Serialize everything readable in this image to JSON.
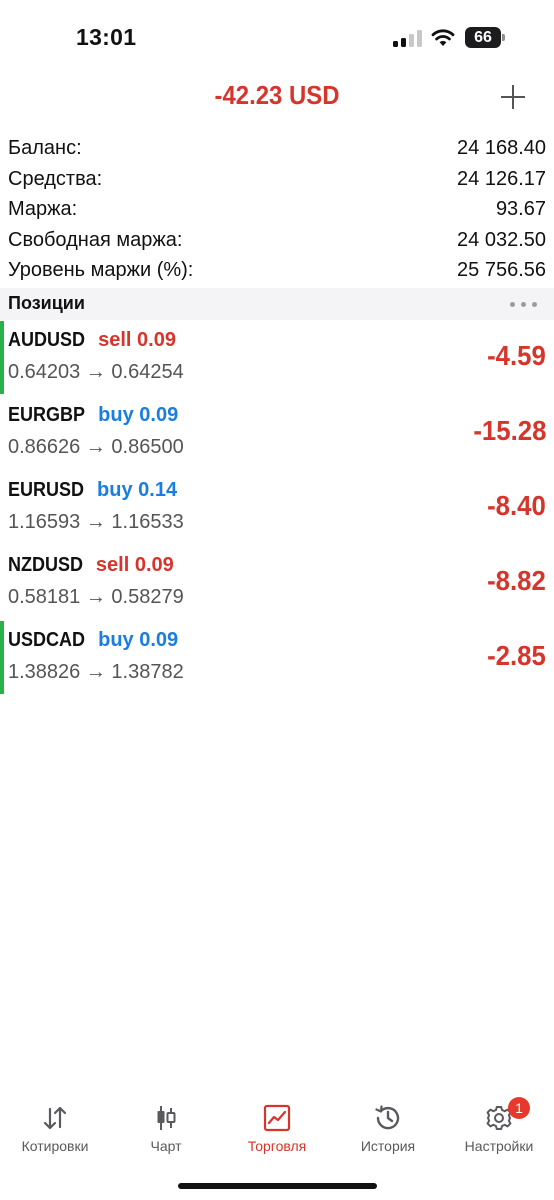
{
  "status_bar": {
    "time": "13:01",
    "battery": "66"
  },
  "header": {
    "total_profit": "-42.23 USD"
  },
  "summary": [
    {
      "label": "Баланс:",
      "value": "24 168.40"
    },
    {
      "label": "Средства:",
      "value": "24 126.17"
    },
    {
      "label": "Маржа:",
      "value": "93.67"
    },
    {
      "label": "Свободная маржа:",
      "value": "24 032.50"
    },
    {
      "label": "Уровень маржи (%):",
      "value": "25 756.56"
    }
  ],
  "positions": {
    "title": "Позиции",
    "items": [
      {
        "symbol": "AUDUSD",
        "side": "sell",
        "volume": "0.09",
        "open": "0.64203",
        "arrow": "→",
        "current": "0.64254",
        "profit": "-4.59",
        "highlighted": true
      },
      {
        "symbol": "EURGBP",
        "side": "buy",
        "volume": "0.09",
        "open": "0.86626",
        "arrow": "→",
        "current": "0.86500",
        "profit": "-15.28",
        "highlighted": false
      },
      {
        "symbol": "EURUSD",
        "side": "buy",
        "volume": "0.14",
        "open": "1.16593",
        "arrow": "→",
        "current": "1.16533",
        "profit": "-8.40",
        "highlighted": false
      },
      {
        "symbol": "NZDUSD",
        "side": "sell",
        "volume": "0.09",
        "open": "0.58181",
        "arrow": "→",
        "current": "0.58279",
        "profit": "-8.82",
        "highlighted": false
      },
      {
        "symbol": "USDCAD",
        "side": "buy",
        "volume": "0.09",
        "open": "1.38826",
        "arrow": "→",
        "current": "1.38782",
        "profit": "-2.85",
        "highlighted": true
      }
    ]
  },
  "nav": {
    "items": [
      {
        "label": "Котировки",
        "icon": "quotes-arrows-icon"
      },
      {
        "label": "Чарт",
        "icon": "candlestick-icon"
      },
      {
        "label": "Торговля",
        "icon": "trade-chart-icon",
        "active": true
      },
      {
        "label": "История",
        "icon": "history-clock-icon"
      },
      {
        "label": "Настройки",
        "icon": "gear-icon",
        "badge": "1"
      }
    ]
  },
  "colors": {
    "loss": "#d6352b",
    "buy": "#1a7de0",
    "sell": "#d6352b",
    "indicator": "#27b34a",
    "badge": "#e8372d"
  }
}
